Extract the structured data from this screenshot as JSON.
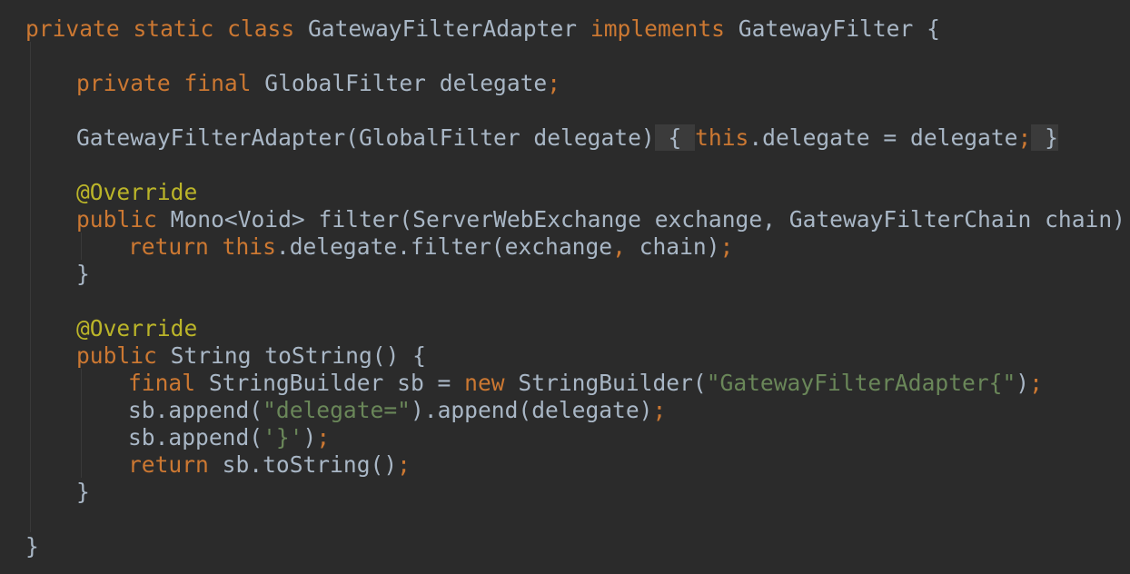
{
  "code": {
    "l1": {
      "a": "private static class ",
      "b": "GatewayFilterAdapter ",
      "c": "implements ",
      "d": "GatewayFilter {"
    },
    "l2": {
      "a": "private final ",
      "b": "GlobalFilter delegate",
      "c": ";"
    },
    "l3": {
      "a": "GatewayFilterAdapter(GlobalFilter delegate)",
      "b": " { ",
      "c": "this",
      ".": ".delegate = delegate",
      "s": ";",
      "e": " }"
    },
    "l4": {
      "a": "@Override"
    },
    "l5": {
      "a": "public ",
      "b": "Mono<Void> filter(ServerWebExchange exchange, GatewayFilterChain chain) {"
    },
    "l6": {
      "a": "return ",
      "b": "this",
      ".": ".delegate.filter(exchange",
      "c": ", ",
      "d": "chain)",
      "s": ";"
    },
    "l7": {
      "a": "}"
    },
    "l8": {
      "a": "@Override"
    },
    "l9": {
      "a": "public ",
      "b": "String toString() {"
    },
    "l10": {
      "a": "final ",
      "b": "StringBuilder sb = ",
      "c": "new ",
      "d": "StringBuilder(",
      "e": "\"GatewayFilterAdapter{\"",
      "f": ")",
      "s": ";"
    },
    "l11": {
      "a": "sb.append(",
      "b": "\"delegate=\"",
      "c": ").append(delegate)",
      "s": ";"
    },
    "l12": {
      "a": "sb.append(",
      "b": "'}'",
      "c": ")",
      "s": ";"
    },
    "l13": {
      "a": "return ",
      "b": "sb.toString()",
      "s": ";"
    },
    "l14": {
      "a": "}"
    },
    "l15": {
      "a": "}"
    }
  }
}
